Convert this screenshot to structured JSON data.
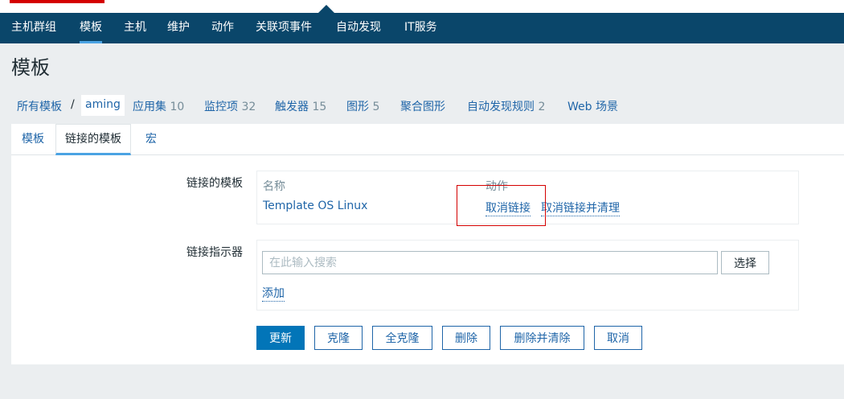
{
  "nav": {
    "items": [
      {
        "label": "主机群组"
      },
      {
        "label": "模板"
      },
      {
        "label": "主机"
      },
      {
        "label": "维护"
      },
      {
        "label": "动作"
      },
      {
        "label": "关联项事件"
      },
      {
        "label": "自动发现"
      },
      {
        "label": "IT服务"
      }
    ],
    "active_index": 1
  },
  "page": {
    "title": "模板"
  },
  "breadcrumb": {
    "all_templates": "所有模板",
    "separator": "/",
    "current": "aming",
    "links": [
      {
        "label": "应用集",
        "count": "10"
      },
      {
        "label": "监控项",
        "count": "32"
      },
      {
        "label": "触发器",
        "count": "15"
      },
      {
        "label": "图形",
        "count": "5"
      },
      {
        "label": "聚合图形",
        "count": ""
      },
      {
        "label": "自动发现规则",
        "count": "2"
      },
      {
        "label": "Web 场景",
        "count": ""
      }
    ]
  },
  "tabs": [
    {
      "label": "模板"
    },
    {
      "label": "链接的模板"
    },
    {
      "label": "宏"
    }
  ],
  "linked_templates": {
    "label": "链接的模板",
    "col_name": "名称",
    "col_action": "动作",
    "rows": [
      {
        "name": "Template OS Linux",
        "unlink": "取消链接",
        "unlink_clear": "取消链接并清理"
      }
    ]
  },
  "link_indicator": {
    "label": "链接指示器",
    "placeholder": "在此输入搜索",
    "select_label": "选择",
    "add_label": "添加"
  },
  "buttons": {
    "update": "更新",
    "clone": "克隆",
    "full_clone": "全克隆",
    "delete": "删除",
    "delete_clear": "删除并清除",
    "cancel": "取消"
  },
  "colors": {
    "nav_bg": "#0a466a",
    "link": "#1f65a8",
    "primary_button": "#0275b8",
    "active_underline": "#4ba3e3",
    "highlight_box": "#d40000"
  }
}
